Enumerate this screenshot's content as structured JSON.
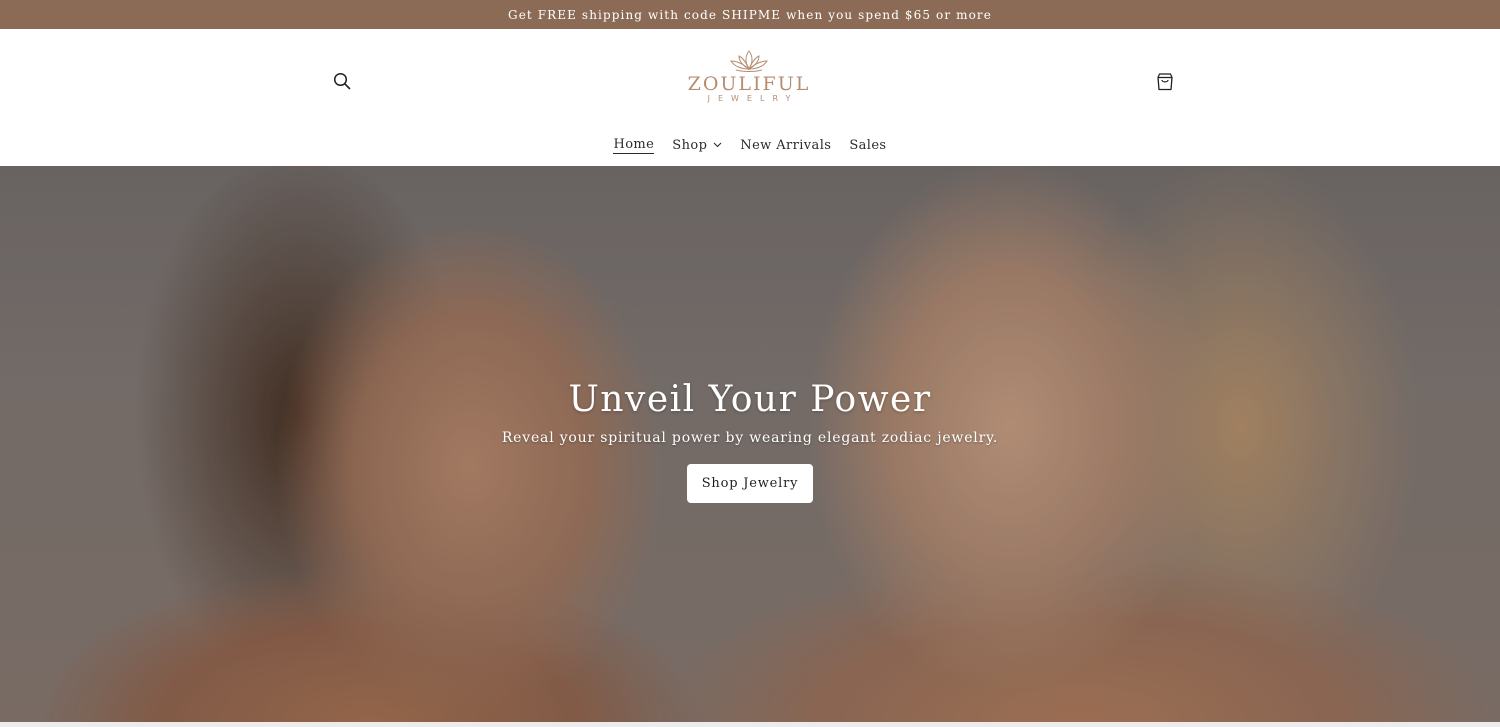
{
  "announcement": {
    "text": "Get FREE shipping with code SHIPME when you spend $65 or more"
  },
  "header": {
    "search_icon": "search-icon",
    "cart_icon": "cart-icon",
    "logo": {
      "brand": "ZOULIFUL",
      "sub": "JEWELRY",
      "mark_icon": "lotus-icon"
    }
  },
  "nav": {
    "items": [
      {
        "label": "Home",
        "active": true
      },
      {
        "label": "Shop",
        "has_dropdown": true
      },
      {
        "label": "New Arrivals"
      },
      {
        "label": "Sales"
      }
    ]
  },
  "hero": {
    "title": "Unveil Your Power",
    "subtitle": "Reveal your spiritual power by wearing elegant zodiac jewelry.",
    "button_label": "Shop Jewelry"
  },
  "colors": {
    "announcement_bg": "#8b6b55",
    "logo_accent": "#b58d73",
    "text_dark": "#1f1f1f"
  }
}
